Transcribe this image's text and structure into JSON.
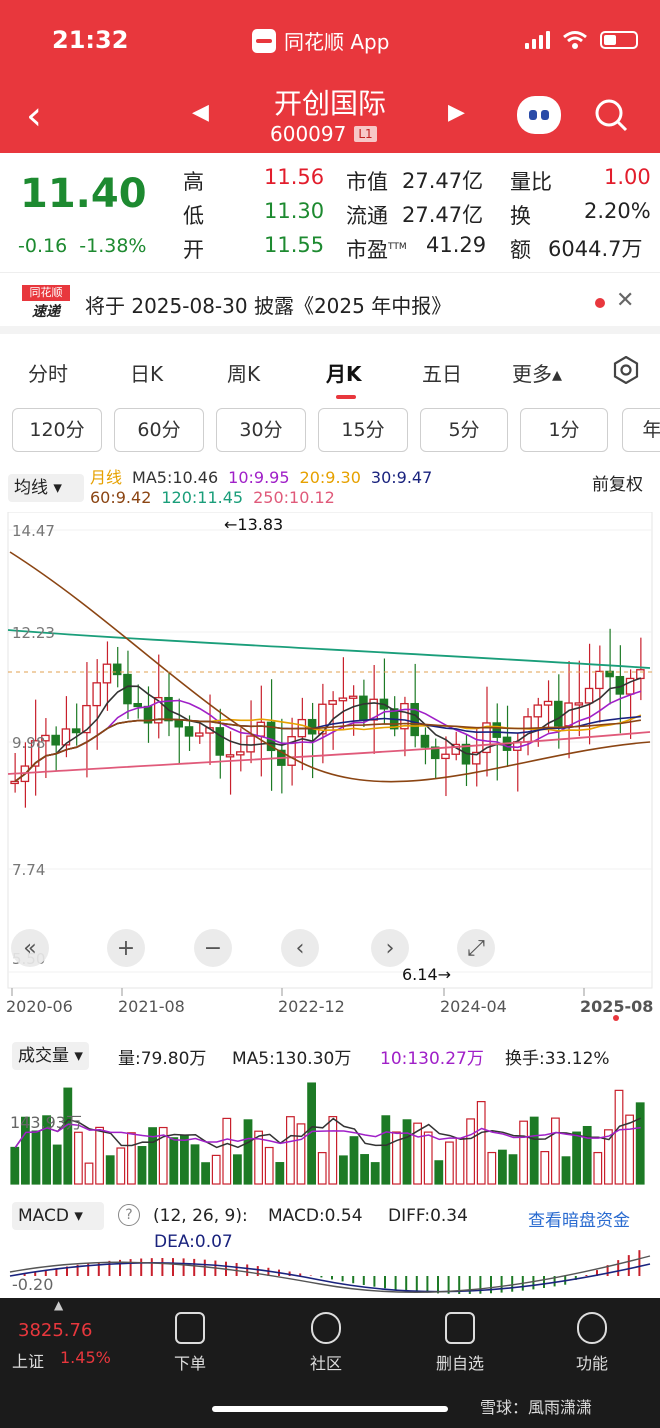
{
  "status": {
    "time": "21:32",
    "app": "同花顺 App"
  },
  "stock": {
    "name": "开创国际",
    "code": "600097",
    "badge": "L1"
  },
  "quote": {
    "price": "11.40",
    "change": "-0.16",
    "change_pct": "-1.38%",
    "high_label": "高",
    "high": "11.56",
    "low_label": "低",
    "low": "11.30",
    "open_label": "开",
    "open": "11.55",
    "mktcap_label": "市值",
    "mktcap": "27.47亿",
    "float_label": "流通",
    "float": "27.47亿",
    "pe_label": "市盈",
    "pe_sup": "TTM",
    "pe": "41.29",
    "volratio_label": "量比",
    "volratio": "1.00",
    "turnover_label": "换",
    "turnover": "2.20%",
    "amount_label": "额",
    "amount": "6044.7万"
  },
  "notice": {
    "logo_top": "同花顺",
    "logo_bottom": "速递",
    "text": "将于 2025-08-30 披露《2025 年中报》"
  },
  "tabs": [
    "分时",
    "日K",
    "周K",
    "月K",
    "五日",
    "更多▴"
  ],
  "periods": [
    "120分",
    "60分",
    "30分",
    "15分",
    "5分",
    "1分",
    "年"
  ],
  "ma": {
    "selector": "均线",
    "restore": "前复权",
    "line1": [
      {
        "text": "月线",
        "color": "#e6a100"
      },
      {
        "text": "MA5:10.46",
        "color": "#333333"
      },
      {
        "text": "10:9.95",
        "color": "#a020c8"
      },
      {
        "text": "20:9.30",
        "color": "#e6a100"
      },
      {
        "text": "30:9.47",
        "color": "#1a237e"
      }
    ],
    "line2": [
      {
        "text": "60:9.42",
        "color": "#8b4513"
      },
      {
        "text": "120:11.45",
        "color": "#1a9e7a"
      },
      {
        "text": "250:10.12",
        "color": "#e05a7a"
      }
    ]
  },
  "chart": {
    "y_labels": [
      "14.47",
      "12.23",
      "9.98",
      "7.74",
      "5.50"
    ],
    "x_labels": [
      "2020-06",
      "2021-08",
      "2022-12",
      "2024-04",
      "2025-08"
    ],
    "max_label": "←13.83",
    "min_label": "6.14→",
    "nav": [
      "«",
      "+",
      "−",
      "‹",
      "›",
      "⤢"
    ]
  },
  "volume": {
    "selector": "成交量",
    "vol": "量:79.80万",
    "ma5": "MA5:130.30万",
    "ma10": "10:130.27万",
    "turnover": "换手:33.12%",
    "y_label": "143.93万"
  },
  "macd": {
    "selector": "MACD",
    "params": "(12, 26, 9):",
    "macd": "MACD:0.54",
    "diff": "DIFF:0.34",
    "dea": "DEA:0.07",
    "link": "查看暗盘资金",
    "y_label": "-0.20"
  },
  "bottom": {
    "index_value": "3825.76",
    "index_name": "上证",
    "index_pct": "1.45%",
    "items": [
      "下单",
      "社区",
      "删自选",
      "功能"
    ],
    "watermark": "雪球：風雨潇潇"
  },
  "colors": {
    "up": "#e21d2c",
    "down": "#1d8a30",
    "header": "#e8373d"
  }
}
